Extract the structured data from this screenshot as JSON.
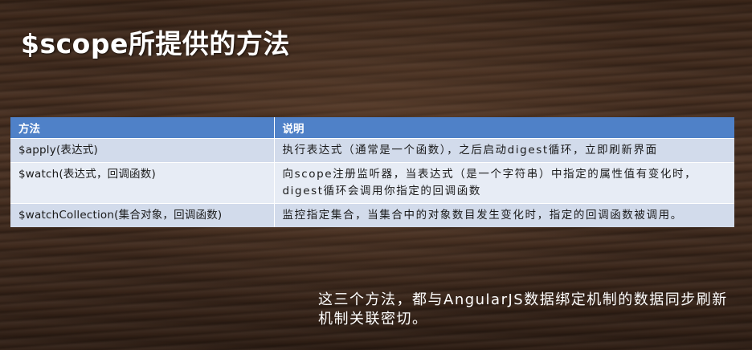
{
  "slide": {
    "title": "$scope所提供的方法",
    "footnote": "这三个方法，都与AngularJS数据绑定机制的数据同步刷新机制关联密切。"
  },
  "table": {
    "headers": {
      "method": "方法",
      "description": "说明"
    },
    "rows": [
      {
        "method": "$apply(表达式)",
        "description": "执行表达式（通常是一个函数），之后启动digest循环，立即刷新界面"
      },
      {
        "method": "$watch(表达式，回调函数)",
        "description": "向scope注册监听器，当表达式（是一个字符串）中指定的属性值有变化时，digest循环会调用你指定的回调函数"
      },
      {
        "method": "$watchCollection(集合对象，回调函数)",
        "description": "监控指定集合，当集合中的对象数目发生变化时，指定的回调函数被调用。"
      }
    ]
  },
  "colors": {
    "header_bg": "#4f81c8",
    "row_odd_bg": "#d2dbeb",
    "row_even_bg": "#e7ecf5",
    "background": "#3b2619"
  }
}
